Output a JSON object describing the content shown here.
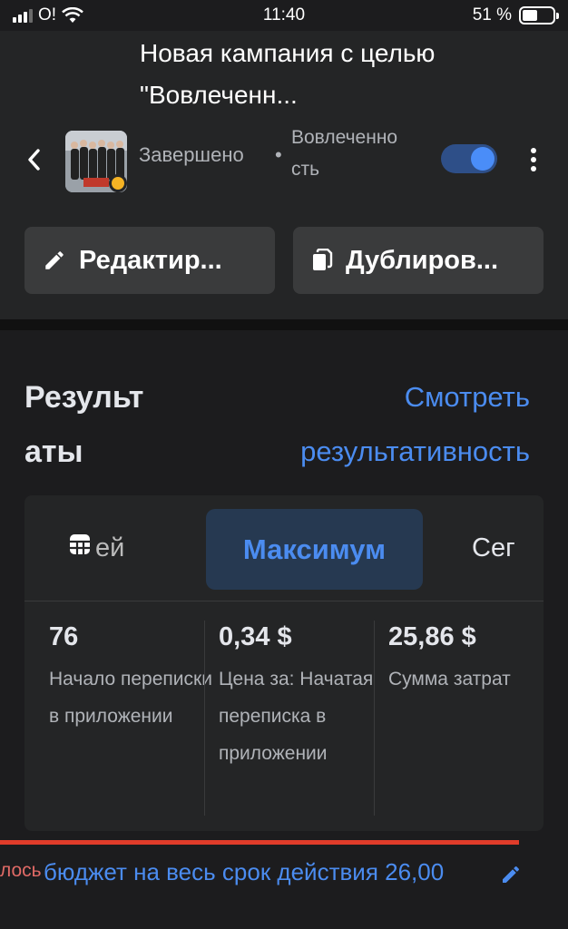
{
  "status_bar": {
    "carrier": "O!",
    "time": "11:40",
    "battery_percent": "51 %",
    "battery_level": 0.51
  },
  "campaign": {
    "title": "Новая кампания с целью \"Вовлеченн...",
    "status": "Завершено",
    "separator": "•",
    "objective": "Вовлеченно сть",
    "active_toggle": true,
    "status_color": "#f5b324"
  },
  "actions": {
    "edit_label": "Редактир...",
    "duplicate_label": "Дублиров..."
  },
  "results": {
    "title": "Результ аты",
    "view_link": "Смотреть результативность",
    "tabs": {
      "prev_partial": "ей",
      "active": "Максимум",
      "next_partial": "Сег"
    },
    "metrics": [
      {
        "value": "76",
        "label": "Начало переписки в приложении"
      },
      {
        "value": "0,34 $",
        "label": "Цена за: Начатая переписка в приложении"
      },
      {
        "value": "25,86 $",
        "label": "Сумма затрат"
      }
    ]
  },
  "budget": {
    "prefix": "лось",
    "text": "бюджет на весь срок действия 26,00"
  },
  "colors": {
    "accent": "#4b8cf0",
    "background": "#1c1c1e",
    "card": "#242526",
    "alert": "#e03c2a"
  },
  "icons": [
    "back-chevron-icon",
    "more-vertical-icon",
    "pencil-icon",
    "copy-icon",
    "table-grid-icon",
    "pencil-edit-icon"
  ]
}
